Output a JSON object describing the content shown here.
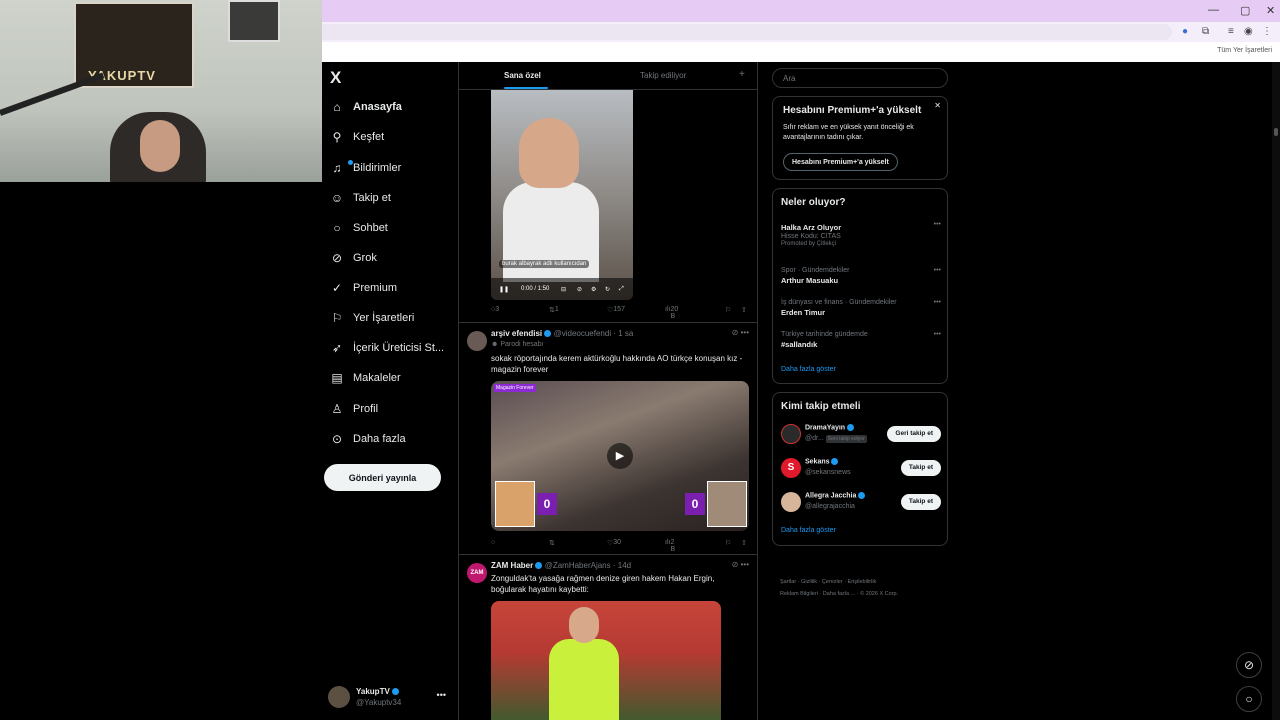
{
  "webcam": {
    "poster_text": "YAKUPTV"
  },
  "browser": {
    "bookmarks_label": "Tüm Yer İşaretleri",
    "window_controls": [
      "—",
      "▢",
      "✕"
    ]
  },
  "nav": {
    "logo": "X",
    "items": [
      {
        "label": "Anasayfa",
        "icon": "home-icon"
      },
      {
        "label": "Keşfet",
        "icon": "search-icon"
      },
      {
        "label": "Bildirimler",
        "icon": "bell-icon"
      },
      {
        "label": "Takip et",
        "icon": "add-user-icon"
      },
      {
        "label": "Sohbet",
        "icon": "chat-icon"
      },
      {
        "label": "Grok",
        "icon": "grok-icon"
      },
      {
        "label": "Premium",
        "icon": "premium-icon"
      },
      {
        "label": "Yer İşaretleri",
        "icon": "bookmark-icon"
      },
      {
        "label": "İçerik Üreticisi St...",
        "icon": "rocket-icon"
      },
      {
        "label": "Makaleler",
        "icon": "article-icon"
      },
      {
        "label": "Profil",
        "icon": "profile-icon"
      },
      {
        "label": "Daha fazla",
        "icon": "more-icon"
      }
    ],
    "post_button": "Gönderi yayınla",
    "account": {
      "name": "YakupTV",
      "handle": "@Yakuptv34"
    }
  },
  "timeline": {
    "tabs": [
      "Sana özel",
      "Takip ediliyor"
    ],
    "post1": {
      "video_overlay": "burak albayrak adlı kullanıcıdan",
      "time": "0:00 / 1:50",
      "stats": {
        "replies": "3",
        "reposts": "1",
        "likes": "157",
        "views": "20 B"
      }
    },
    "post2": {
      "name": "arşiv efendisi",
      "handle": "@videocuefendi",
      "time": "1 sa",
      "tag": "Parodi hesabı",
      "text": "sokak röportajında kerem aktürkoğlu hakkında AO türkçe konuşan kız - magazin forever",
      "media_label": "Magazin Forever",
      "score_left": "0",
      "score_right": "0",
      "stats": {
        "replies": "",
        "reposts": "",
        "likes": "30",
        "views": "2 B"
      }
    },
    "post3": {
      "name": "ZAM Haber",
      "handle": "@ZamHaberAjans",
      "time": "14d",
      "avatar_text": "ZAM",
      "text": "Zonguldak'ta yasağa rağmen denize giren hakem Hakan Ergin, boğularak hayatını kaybetti:"
    }
  },
  "right": {
    "search_placeholder": "Ara",
    "premium": {
      "title": "Hesabını Premium+'a yükselt",
      "desc": "Sıfır reklam ve en yüksek yanıt önceliği ek avantajlarının tadını çıkar.",
      "button": "Hesabını Premium+'a yükselt"
    },
    "trends": {
      "title": "Neler oluyor?",
      "items": [
        {
          "title": "Halka Arz Oluyor",
          "sub": "Hisse Kodu: CITAS",
          "promo": "Promoted by Çitlekçi"
        },
        {
          "category": "Spor · Gündemdekiler",
          "title": "Arthur Masuaku"
        },
        {
          "category": "İş dünyası ve finans · Gündemdekiler",
          "title": "Erden Timur"
        },
        {
          "category": "Türkiye tarihinde gündemde",
          "title": "#sallandık"
        }
      ],
      "show_more": "Daha fazla göster"
    },
    "who_to_follow": {
      "title": "Kimi takip etmeli",
      "items": [
        {
          "name": "DramaYayın",
          "handle": "@dr...",
          "follows_you": "Seni takip ediyor",
          "button": "Geri takip et"
        },
        {
          "name": "Sekans",
          "handle": "@sekansnews",
          "button": "Takip et"
        },
        {
          "name": "Allegra Jacchia",
          "handle": "@allegrajacchia",
          "button": "Takip et"
        }
      ],
      "show_more": "Daha fazla göster"
    },
    "footer": [
      "Şartlar",
      "Gizlilik",
      "Çerezler",
      "Erişilebilirlik",
      "Reklam Bilgileri",
      "Daha fazla ...",
      "© 2026 X Corp."
    ]
  },
  "colors": {
    "accent": "#1d9bf0",
    "tab_bg": "#e6ccf4",
    "score_purple": "#7a1fb0"
  }
}
